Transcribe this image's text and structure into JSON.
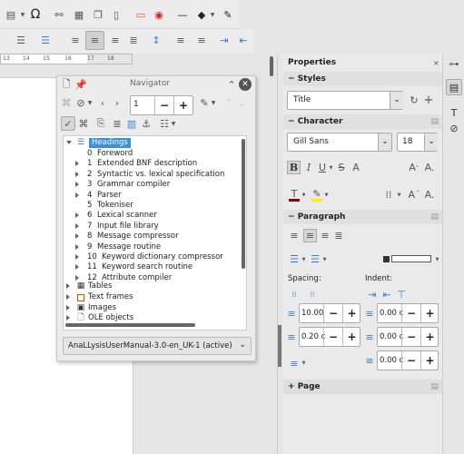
{
  "ruler": {
    "ticks": [
      "13",
      "14",
      "15",
      "16",
      "17",
      "18"
    ]
  },
  "navigator": {
    "title": "Navigator",
    "page_number": "1",
    "tree": {
      "headings_label": "Headings",
      "headings": [
        {
          "num": "0",
          "text": "Foreword",
          "expandable": false
        },
        {
          "num": "1",
          "text": "Extended BNF description",
          "expandable": true
        },
        {
          "num": "2",
          "text": "Syntactic vs. lexical specification",
          "expandable": true
        },
        {
          "num": "3",
          "text": "Grammar compiler",
          "expandable": true
        },
        {
          "num": "4",
          "text": "Parser",
          "expandable": true
        },
        {
          "num": "5",
          "text": "Tokeniser",
          "expandable": false
        },
        {
          "num": "6",
          "text": "Lexical scanner",
          "expandable": true
        },
        {
          "num": "7",
          "text": "Input file library",
          "expandable": true
        },
        {
          "num": "8",
          "text": "Message compressor",
          "expandable": true
        },
        {
          "num": "9",
          "text": "Message routine",
          "expandable": true
        },
        {
          "num": "10",
          "text": "Keyword dictionary compressor",
          "expandable": true
        },
        {
          "num": "11",
          "text": "Keyword search routine",
          "expandable": true
        },
        {
          "num": "12",
          "text": "Attribute compiler",
          "expandable": true
        }
      ],
      "categories": [
        "Tables",
        "Text frames",
        "Images",
        "OLE objects"
      ]
    },
    "document_select": "AnaLLysisUserManual-3.0-en_UK-1 (active)"
  },
  "properties": {
    "title": "Properties",
    "styles": {
      "header": "Styles",
      "value": "Title"
    },
    "character": {
      "header": "Character",
      "font": "Gill Sans",
      "size": "18"
    },
    "paragraph": {
      "header": "Paragraph",
      "spacing_label": "Spacing:",
      "indent_label": "Indent:",
      "above": "10.00",
      "below": "0.20 c",
      "indent_before": "0.00 c",
      "indent_after": "0.00 c",
      "first_line": "0.00 c"
    },
    "page": {
      "header": "Page"
    }
  },
  "colors": {
    "selection": "#3d8ee0",
    "font_color": "#8b0000",
    "highlight": "#ffee00"
  }
}
